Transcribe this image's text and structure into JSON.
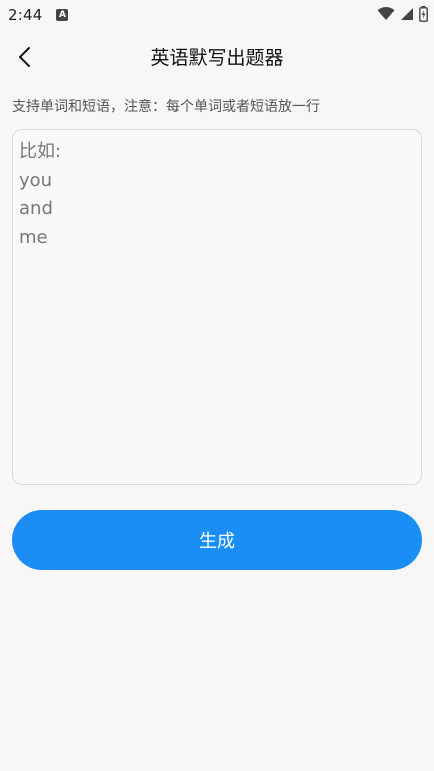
{
  "status_bar": {
    "time": "2:44",
    "notification_letter": "A"
  },
  "header": {
    "title": "英语默写出题器"
  },
  "main": {
    "hint": "支持单词和短语，注意：每个单词或者短语放一行",
    "input_placeholder": "比如:\nyou\nand\nme",
    "input_value": "",
    "generate_label": "生成"
  },
  "colors": {
    "accent": "#1b8ef5",
    "background": "#f7f7f7"
  },
  "icons": {
    "back": "chevron-left-icon",
    "wifi": "wifi-icon",
    "signal": "cell-signal-icon",
    "battery": "battery-icon"
  }
}
